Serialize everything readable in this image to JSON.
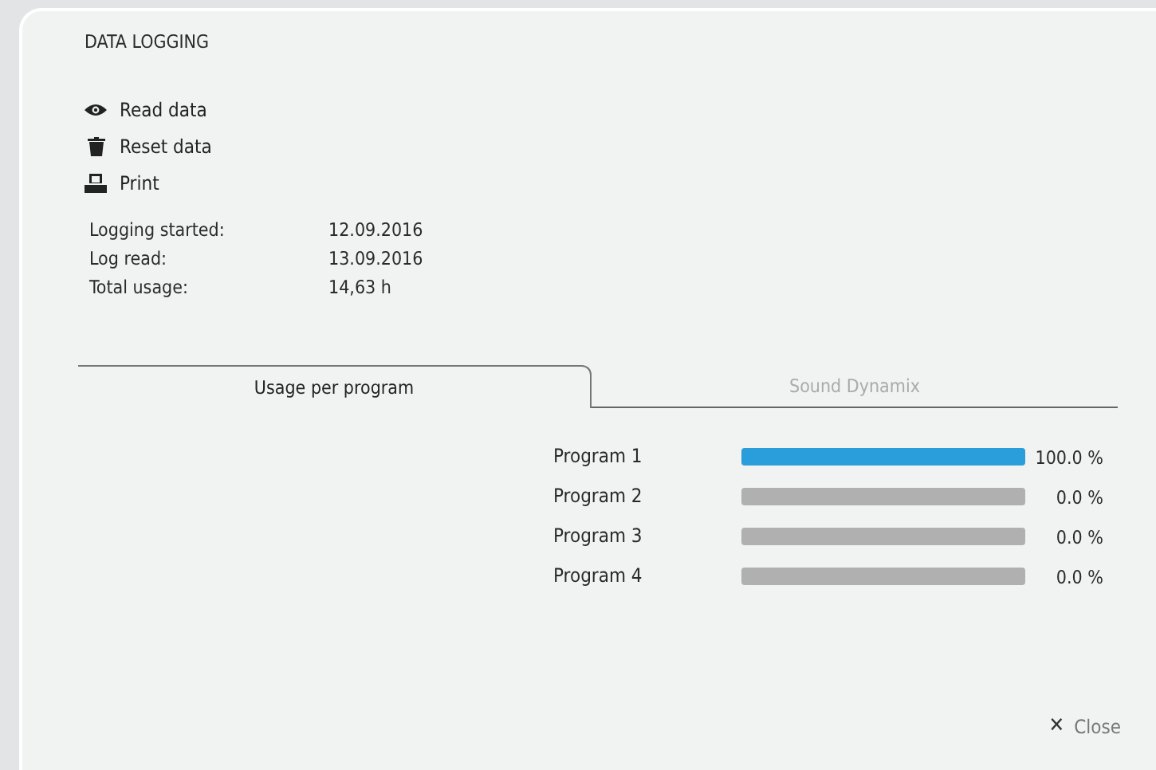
{
  "title": "DATA LOGGING",
  "actions": [
    {
      "kind": "eye",
      "label": "Read data"
    },
    {
      "kind": "trash",
      "label": "Reset data"
    },
    {
      "kind": "print",
      "label": "Print"
    }
  ],
  "info": [
    {
      "label": "Logging started:",
      "value": "12.09.2016"
    },
    {
      "label": "Log read:",
      "value": "13.09.2016"
    },
    {
      "label": "Total usage:",
      "value": "14,63 h"
    }
  ],
  "tabs": [
    {
      "label": "Usage per program",
      "selected": true
    },
    {
      "label": "Sound Dynamix",
      "selected": false
    }
  ],
  "programs": [
    {
      "name": "Program 1",
      "level": 1.0,
      "reading": "100.0 %"
    },
    {
      "name": "Program 2",
      "level": 0,
      "reading": "0.0 %"
    },
    {
      "name": "Program 3",
      "level": 0,
      "reading": "0.0 %"
    },
    {
      "name": "Program 4",
      "level": 0,
      "reading": "0.0 %"
    }
  ],
  "close": {
    "glyph": "✕",
    "label": "Close"
  }
}
